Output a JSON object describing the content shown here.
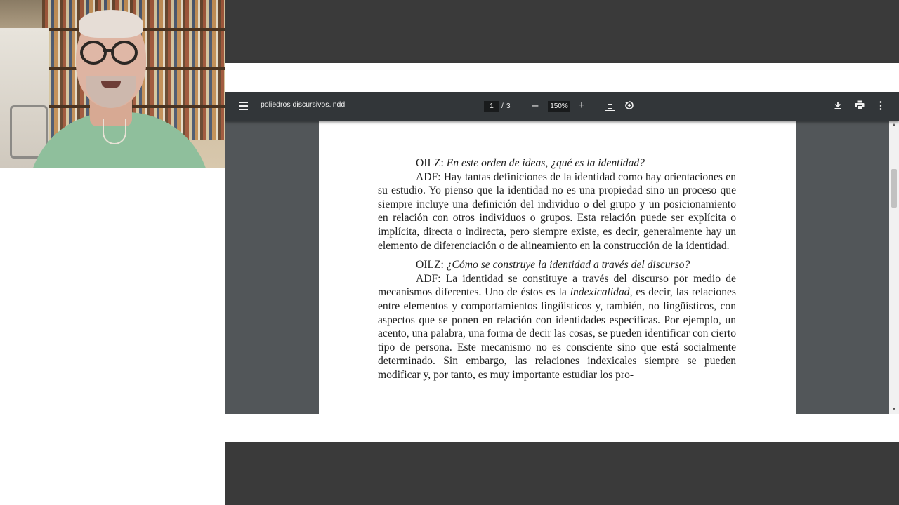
{
  "toolbar": {
    "title": "poliedros discursivos.indd",
    "page_current": "1",
    "page_separator": "/",
    "page_total": "3",
    "zoom_out": "–",
    "zoom_level": "150%",
    "zoom_in": "+",
    "icons": [
      "menu-icon",
      "fit-page-icon",
      "rotate-icon",
      "download-icon",
      "print-icon",
      "more-options-icon"
    ]
  },
  "document": {
    "q1_speaker": "OILZ: ",
    "q1_text": "En este orden de ideas, ¿qué es la identidad?",
    "a1_speaker": "ADF: ",
    "a1_text": "Hay tantas definiciones de la identidad como hay orientaciones en su estudio. Yo pienso que la identidad no es una propiedad sino un proceso que siempre incluye una definición del individuo o del grupo y un posicionamiento en relación con otros individuos o grupos. Esta relación puede ser explícita o implícita, directa o indirecta, pero siempre existe, es decir, generalmente hay un elemento de diferenciación o de alineamiento en la construcción de la identidad.",
    "q2_speaker": "OILZ: ",
    "q2_text": "¿Cómo se construye la identidad a través del discurso?",
    "a2_speaker": "ADF: ",
    "a2_text_1": "La identidad se constituye a través del discurso por medio de mecanismos diferentes. Uno de éstos es la ",
    "a2_italic": "indexicalidad",
    "a2_text_2": ", es decir, las relaciones entre elementos y comportamientos lingüísticos y, también, no lingüísticos, con aspectos que se ponen en relación con identidades específicas. Por ejemplo, un acento, una palabra, una forma de decir las cosas, se pueden identificar con cierto tipo de persona. Este mecanismo no es consciente sino que está socialmente determinado. Sin embargo, las relaciones indexicales siempre se pueden modificar y, por tanto, es muy importante estudiar los pro-"
  },
  "colors": {
    "toolbar_bg": "#323639",
    "viewer_bg": "#525659",
    "surround_dark": "#3a3a3a"
  }
}
